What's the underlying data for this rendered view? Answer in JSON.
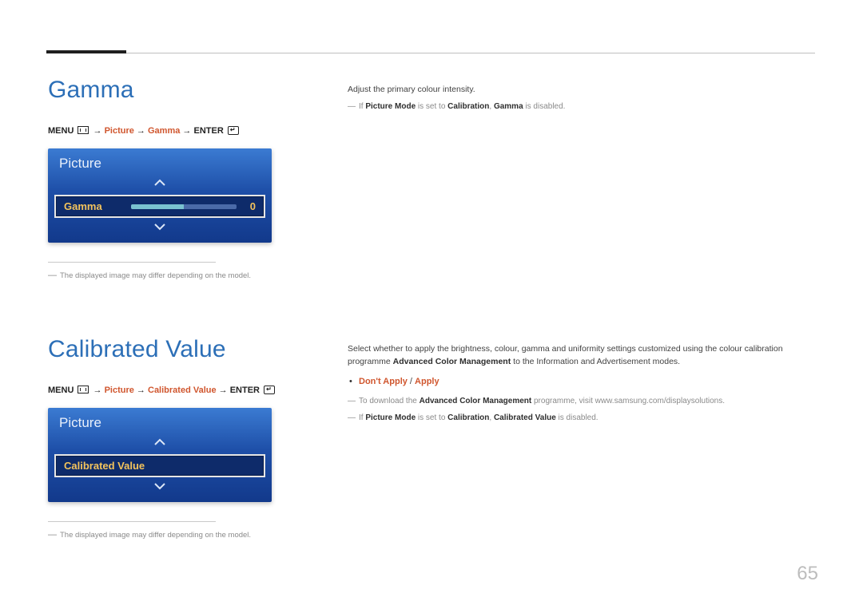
{
  "page_number": "65",
  "gamma": {
    "title": "Gamma",
    "menu_path": {
      "prefix": "MENU",
      "parts1": "Picture",
      "parts2": "Gamma",
      "suffix": "ENTER"
    },
    "osd": {
      "header": "Picture",
      "row_label": "Gamma",
      "row_value": "0"
    },
    "footnote": "The displayed image may differ depending on the model.",
    "body": {
      "p1": "Adjust the primary colour intensity.",
      "note_prefix": "If ",
      "note_pm": "Picture Mode",
      "note_mid": " is set to ",
      "note_cal": "Calibration",
      "note_sep": ", ",
      "note_g": "Gamma",
      "note_end": " is disabled."
    }
  },
  "calibrated": {
    "title": "Calibrated Value",
    "menu_path": {
      "prefix": "MENU",
      "parts1": "Picture",
      "parts2": "Calibrated Value",
      "suffix": "ENTER"
    },
    "osd": {
      "header": "Picture",
      "row_label": "Calibrated Value"
    },
    "footnote": "The displayed image may differ depending on the model.",
    "body": {
      "p1": "Select whether to apply the brightness, colour, gamma and uniformity settings customized using the colour calibration programme ",
      "p1_bold": "Advanced Color Management",
      "p1_tail": " to the Information and Advertisement modes.",
      "options_a": "Don't Apply",
      "options_sep": " / ",
      "options_b": "Apply",
      "note1_prefix": "To download the ",
      "note1_bold": "Advanced Color Management",
      "note1_tail": " programme, visit www.samsung.com/displaysolutions.",
      "note2_prefix": "If ",
      "note2_pm": "Picture Mode",
      "note2_mid": " is set to ",
      "note2_cal": "Calibration",
      "note2_sep": ", ",
      "note2_cv": "Calibrated Value",
      "note2_end": " is disabled."
    }
  }
}
